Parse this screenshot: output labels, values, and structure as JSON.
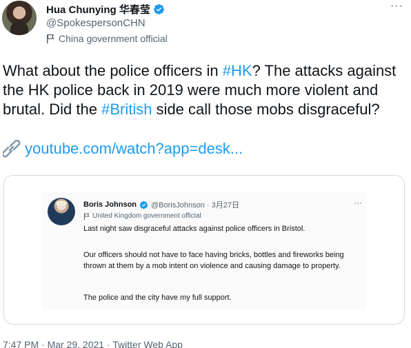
{
  "tweet": {
    "author": {
      "name": "Hua Chunying 华春莹",
      "handle": "@SpokespersonCHN",
      "label": "China government official"
    },
    "text": {
      "part1": "What about the police officers in ",
      "hashtag1": "#HK",
      "part2": "? The attacks against the HK police back in 2019 were much more violent and brutal. Did the ",
      "hashtag2": "#British",
      "part3": " side call those mobs disgraceful?"
    },
    "link": "youtube.com/watch?app=desk...",
    "timestamp": "7:47 PM · Mar 29, 2021 · Twitter Web App",
    "more_glyph": "···"
  },
  "embedded": {
    "author": {
      "name": "Boris Johnson",
      "handle_date": "@BorisJohnson · 3月27日",
      "label": "United Kingdom government official"
    },
    "paragraph1": "Last night saw disgraceful attacks against police officers in Bristol.",
    "paragraph2": "Our officers should not have to face having bricks, bottles and fireworks being thrown at them by a mob intent on violence and causing damage to property.",
    "paragraph3": "The police and the city have my full support.",
    "more_glyph": "···"
  },
  "colors": {
    "accent": "#1d9bf0",
    "secondary_text": "#536471",
    "border": "#cfd9de"
  },
  "icons": [
    "verified-badge-icon",
    "flag-icon",
    "link-icon",
    "more-icon"
  ]
}
